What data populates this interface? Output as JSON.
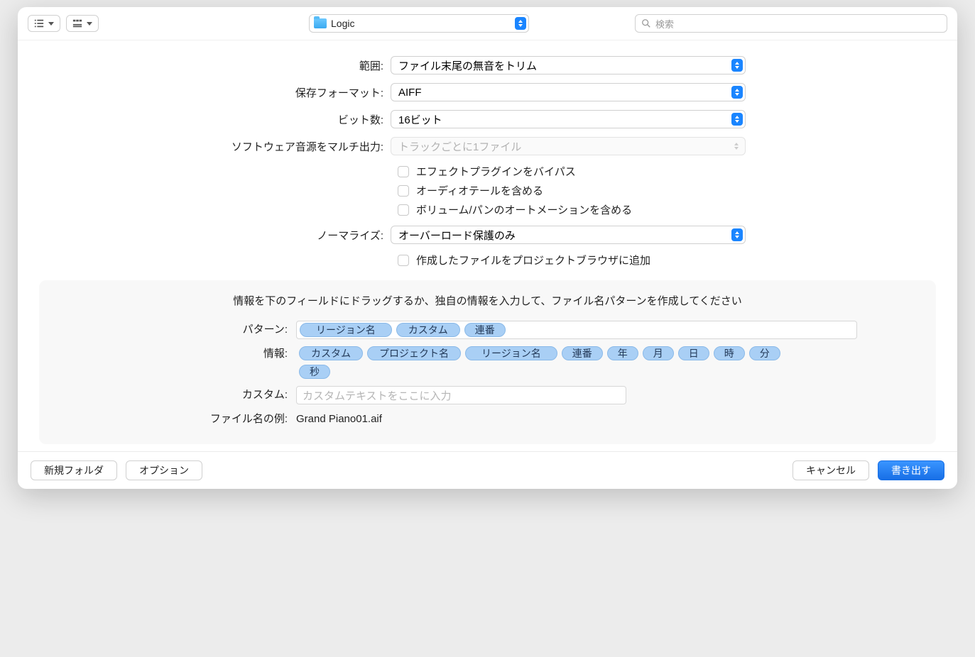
{
  "toolbar": {
    "location": "Logic",
    "search_placeholder": "検索"
  },
  "form": {
    "range": {
      "label": "範囲:",
      "value": "ファイル末尾の無音をトリム"
    },
    "save_format": {
      "label": "保存フォーマット:",
      "value": "AIFF"
    },
    "bit_depth": {
      "label": "ビット数:",
      "value": "16ビット"
    },
    "multi_output": {
      "label": "ソフトウェア音源をマルチ出力:",
      "value": "トラックごとに1ファイル"
    },
    "cb_bypass": "エフェクトプラグインをバイパス",
    "cb_tail": "オーディオテールを含める",
    "cb_volpan": "ボリューム/パンのオートメーションを含める",
    "normalize": {
      "label": "ノーマライズ:",
      "value": "オーバーロード保護のみ"
    },
    "cb_add_browser": "作成したファイルをプロジェクトブラウザに追加"
  },
  "pattern": {
    "instruction": "情報を下のフィールドにドラッグするか、独自の情報を入力して、ファイル名パターンを作成してください",
    "label_pattern": "パターン:",
    "tokens_pattern": [
      "リージョン名",
      "カスタム",
      "連番"
    ],
    "label_info": "情報:",
    "tokens_info": [
      "カスタム",
      "プロジェクト名",
      "リージョン名",
      "連番",
      "年",
      "月",
      "日",
      "時",
      "分",
      "秒"
    ],
    "label_custom": "カスタム:",
    "custom_placeholder": "カスタムテキストをここに入力",
    "label_example": "ファイル名の例:",
    "example_value": "Grand Piano01.aif"
  },
  "footer": {
    "new_folder": "新規フォルダ",
    "options": "オプション",
    "cancel": "キャンセル",
    "export": "書き出す"
  }
}
